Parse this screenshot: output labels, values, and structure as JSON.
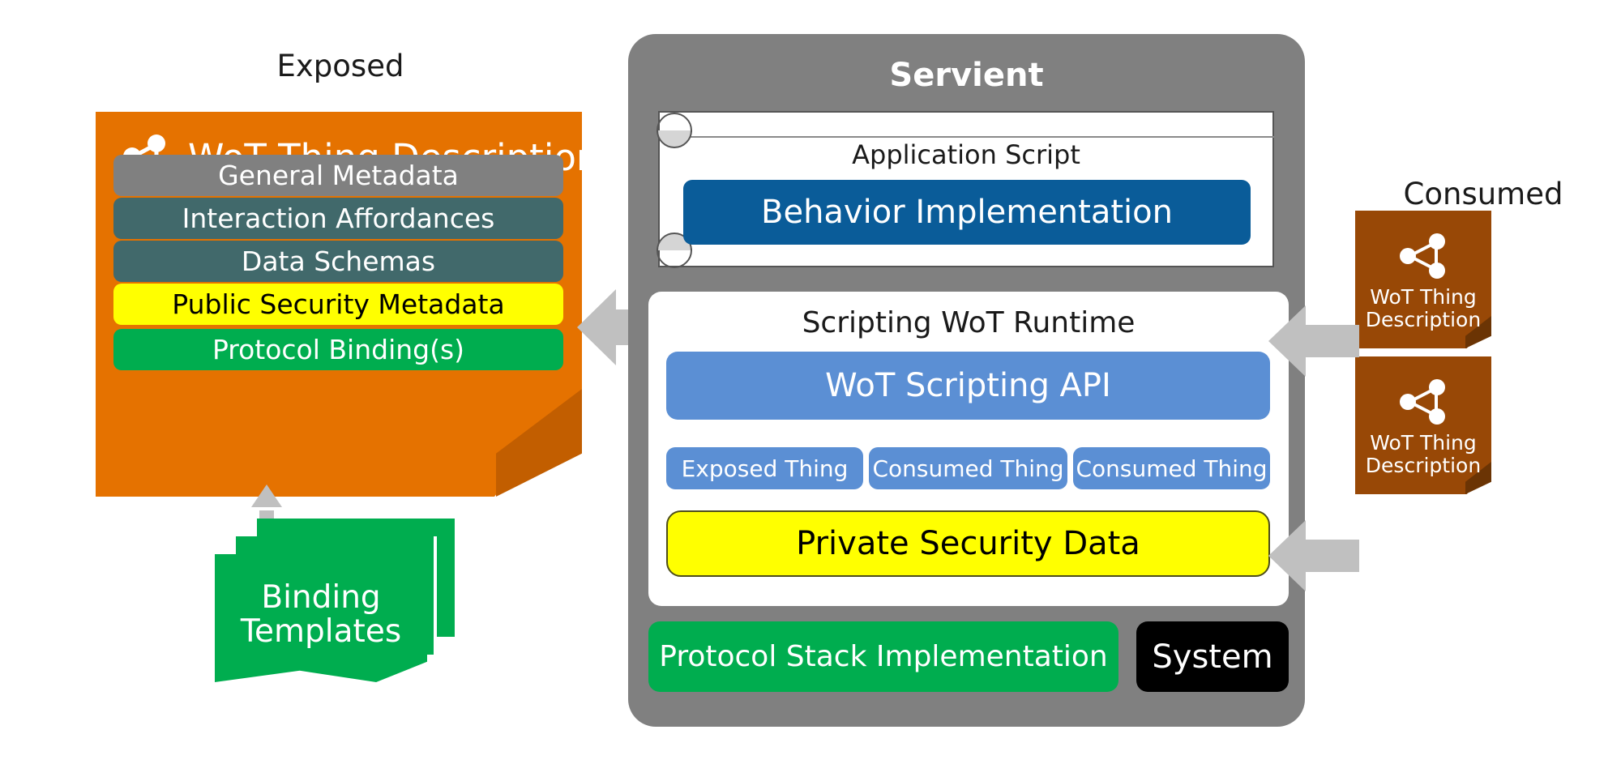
{
  "captions": {
    "exposed": "Exposed",
    "consumed": "Consumed"
  },
  "exposed_panel": {
    "icon": "wot-share-icon",
    "title": "WoT Thing Description",
    "rows": [
      {
        "label": "General Metadata",
        "style": "gray",
        "color": "#808080"
      },
      {
        "label": "Interaction Affordances",
        "style": "teal",
        "color": "#41696b"
      },
      {
        "label": "Data Schemas",
        "style": "teal",
        "color": "#41696b"
      },
      {
        "label": "Public Security Metadata",
        "style": "yellow",
        "color": "#ffff00"
      },
      {
        "label": "Protocol Binding(s)",
        "style": "green",
        "color": "#00ad4f"
      }
    ],
    "panel_color": "#e57200",
    "fold_color": "#c25e00"
  },
  "binding_templates": {
    "line1": "Binding",
    "line2": "Templates",
    "color": "#00ad4f"
  },
  "servient": {
    "title": "Servient",
    "panel_color": "#808080",
    "application_script": {
      "label": "Application Script",
      "behavior_implementation": "Behavior Implementation",
      "behavior_color": "#0a5c99"
    },
    "runtime": {
      "label": "Scripting WoT Runtime",
      "scripting_api": "WoT Scripting API",
      "scripting_api_color": "#5b8fd4",
      "things": [
        "Exposed Thing",
        "Consumed Thing",
        "Consumed Thing"
      ],
      "private_security_data": "Private Security Data",
      "private_security_color": "#ffff00"
    },
    "bottom": {
      "protocol_stack": "Protocol Stack Implementation",
      "protocol_stack_color": "#00ad4f",
      "system": "System",
      "system_color": "#000000"
    }
  },
  "consumed_cards": [
    {
      "icon": "wot-share-icon",
      "line1": "WoT Thing",
      "line2": "Description"
    },
    {
      "icon": "wot-share-icon",
      "line1": "WoT Thing",
      "line2": "Description"
    }
  ],
  "colors": {
    "arrow_gray": "#c0c0c0",
    "consumed_card": "#984806",
    "consumed_fold": "#6b3404"
  }
}
